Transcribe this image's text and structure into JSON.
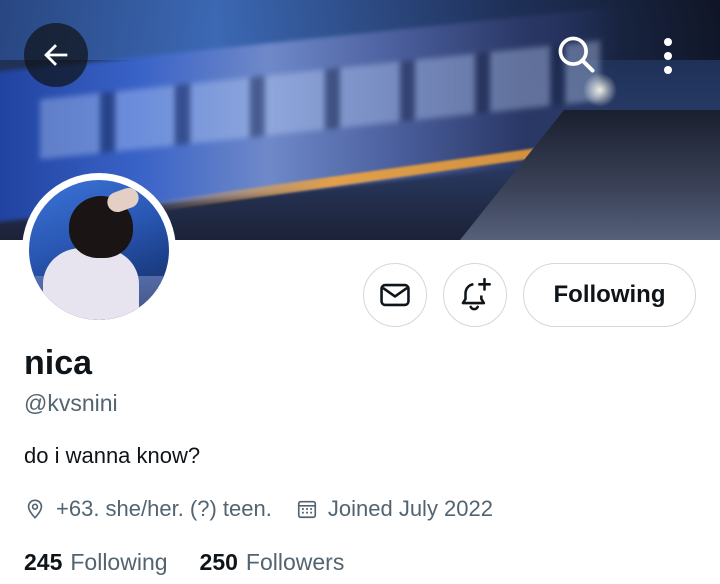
{
  "banner": {
    "back_icon": "arrow-left-icon",
    "search_icon": "search-icon",
    "more_icon": "more-vertical-icon"
  },
  "profile": {
    "display_name": "nica",
    "handle": "@kvsnini",
    "bio": "do i wanna know?",
    "location": "+63. she/her. (?) teen.",
    "location_icon": "location-pin-icon",
    "joined": "Joined July 2022",
    "joined_icon": "calendar-icon"
  },
  "actions": {
    "message_icon": "envelope-icon",
    "notify_icon": "bell-plus-icon",
    "following_label": "Following"
  },
  "stats": {
    "following_count": "245",
    "following_label": "Following",
    "followers_count": "250",
    "followers_label": "Followers"
  },
  "colors": {
    "text_primary": "#0f1419",
    "text_secondary": "#536471",
    "border": "#cfd9de"
  }
}
